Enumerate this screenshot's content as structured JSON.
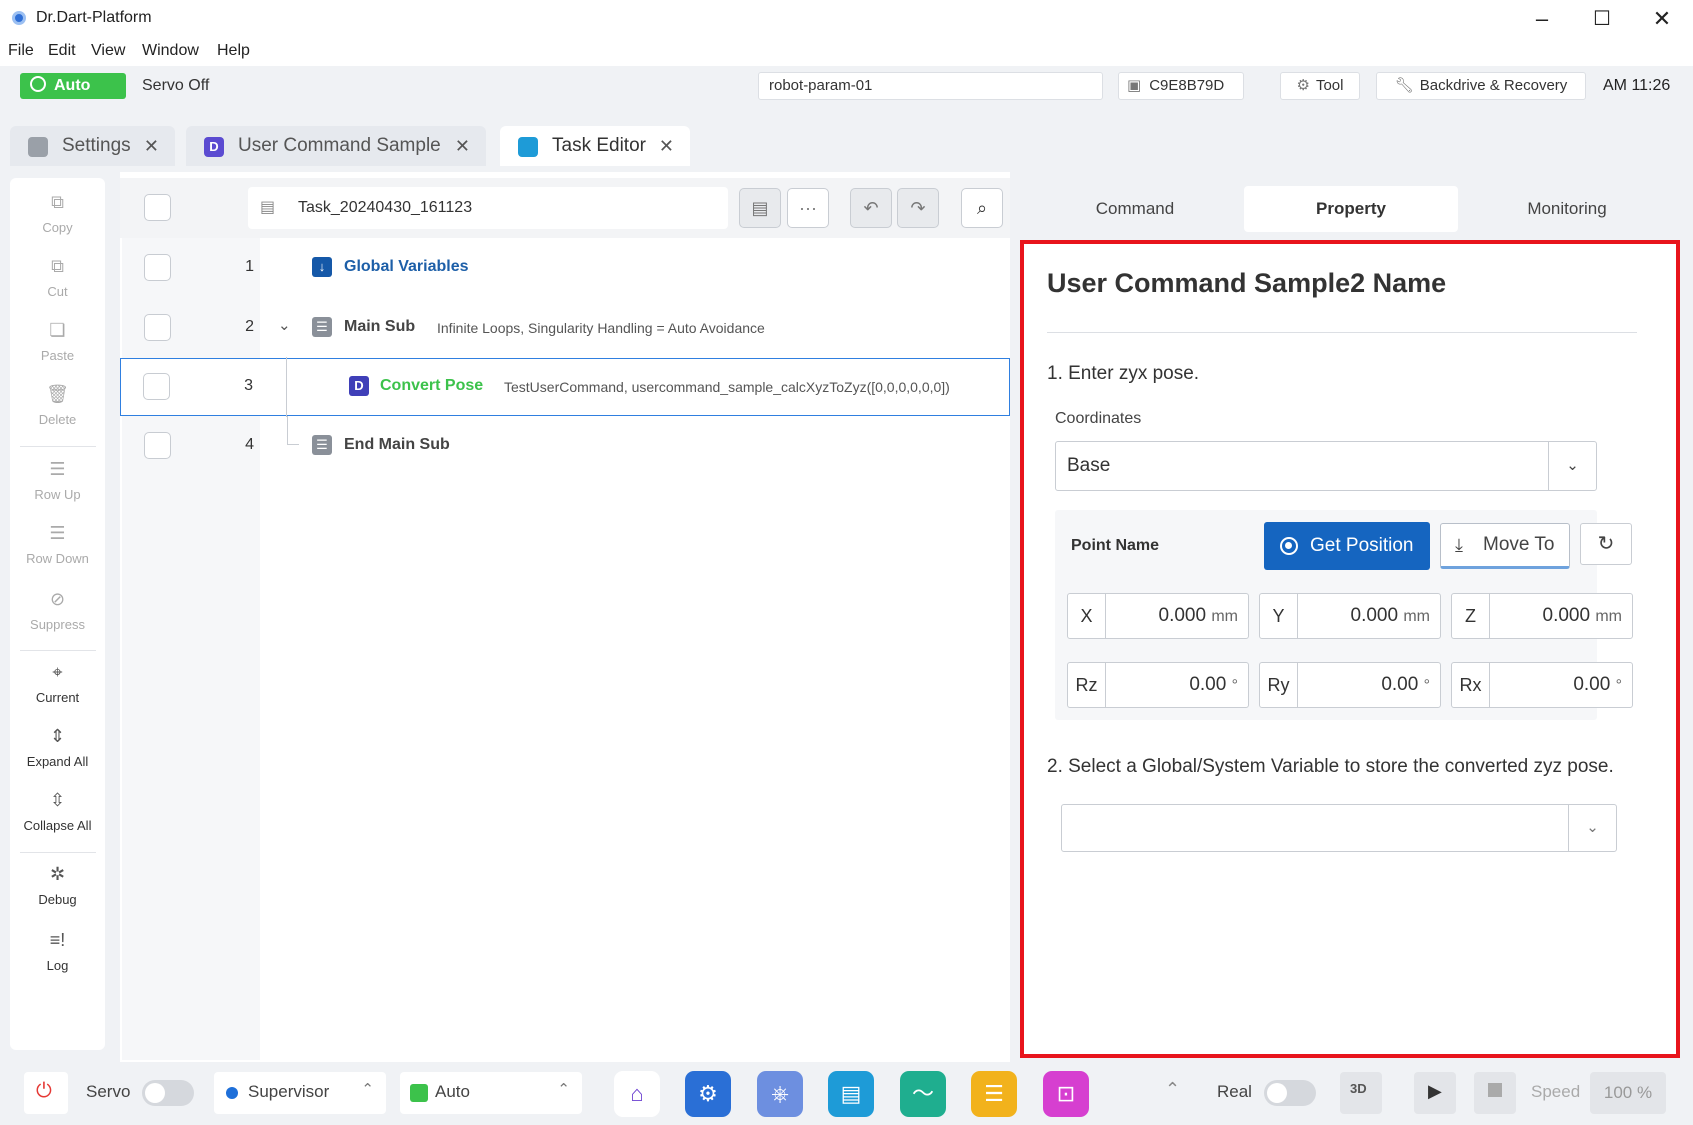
{
  "app": {
    "title": "Dr.Dart-Platform"
  },
  "menu": [
    "File",
    "Edit",
    "View",
    "Window",
    "Help"
  ],
  "status": {
    "mode": "Auto",
    "servo": "Servo Off",
    "robot_param": "robot-param-01",
    "serial": "C9E8B79D",
    "tool": "Tool",
    "backdrive": "Backdrive & Recovery",
    "clock": "AM 11:26"
  },
  "tabs": [
    {
      "label": "Settings",
      "active": false
    },
    {
      "label": "User Command Sample",
      "active": false
    },
    {
      "label": "Task Editor",
      "active": true
    }
  ],
  "toolbar": [
    {
      "label": "Copy",
      "icon": "copy-icon"
    },
    {
      "label": "Cut",
      "icon": "cut-icon"
    },
    {
      "label": "Paste",
      "icon": "paste-icon"
    },
    {
      "label": "Delete",
      "icon": "trash-icon"
    },
    {
      "label": "Row Up",
      "icon": "row-up-icon"
    },
    {
      "label": "Row Down",
      "icon": "row-down-icon"
    },
    {
      "label": "Suppress",
      "icon": "suppress-icon"
    },
    {
      "label": "Current",
      "icon": "crosshair-icon"
    },
    {
      "label": "Expand All",
      "icon": "expand-icon"
    },
    {
      "label": "Collapse All",
      "icon": "collapse-icon"
    },
    {
      "label": "Debug",
      "icon": "bug-icon"
    },
    {
      "label": "Log",
      "icon": "log-icon"
    }
  ],
  "editor": {
    "task_name": "Task_20240430_161123",
    "rows": [
      {
        "num": "1",
        "command": "Global Variables",
        "desc": ""
      },
      {
        "num": "2",
        "command": "Main Sub",
        "desc": "Infinite Loops, Singularity Handling = Auto Avoidance"
      },
      {
        "num": "3",
        "command": "Convert Pose",
        "desc": "TestUserCommand, usercommand_sample_calcXyzToZyz([0,0,0,0,0,0])"
      },
      {
        "num": "4",
        "command": "End Main Sub",
        "desc": ""
      }
    ]
  },
  "right_tabs": [
    "Command",
    "Property",
    "Monitoring"
  ],
  "property": {
    "title": "User Command Sample2 Name",
    "step1": "1. Enter zyx pose.",
    "coord_label": "Coordinates",
    "coord_value": "Base",
    "point_name": "Point Name",
    "get_position": "Get Position",
    "move_to": "Move To",
    "fields": [
      {
        "label": "X",
        "value": "0.000",
        "unit": "mm"
      },
      {
        "label": "Y",
        "value": "0.000",
        "unit": "mm"
      },
      {
        "label": "Z",
        "value": "0.000",
        "unit": "mm"
      },
      {
        "label": "Rz",
        "value": "0.00",
        "unit": "°"
      },
      {
        "label": "Ry",
        "value": "0.00",
        "unit": "°"
      },
      {
        "label": "Rx",
        "value": "0.00",
        "unit": "°"
      }
    ],
    "step2": "2. Select a Global/System Variable to store the converted zyz pose.",
    "variable_value": ""
  },
  "bottom": {
    "servo": "Servo",
    "role": "Supervisor",
    "mode": "Auto",
    "real": "Real",
    "speed": "Speed",
    "speed_value": "100 %"
  },
  "colors": {
    "accent": "#1565c0",
    "auto_green": "#3cc24b",
    "highlight": "#e8141c",
    "command_green": "#3cc24b"
  }
}
